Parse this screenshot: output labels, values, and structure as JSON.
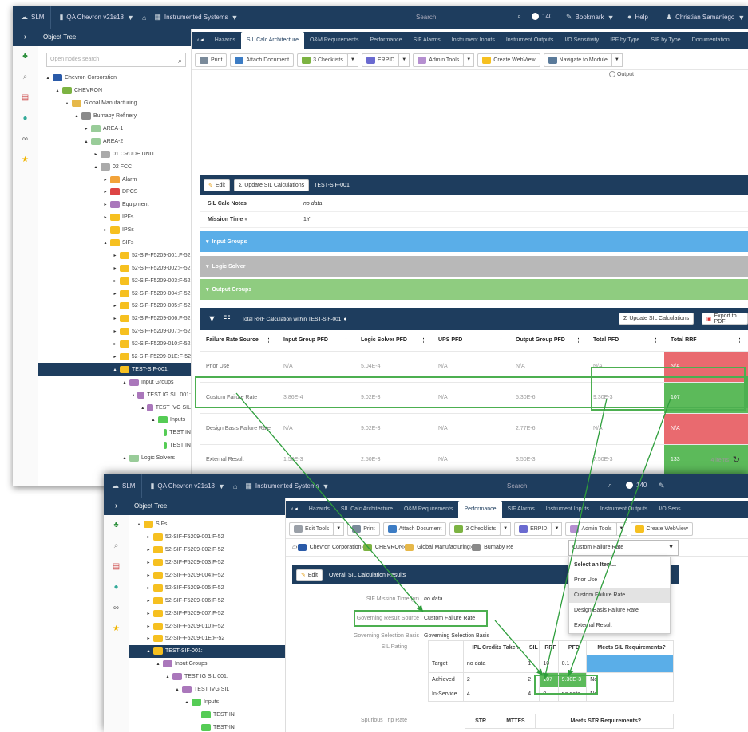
{
  "top": {
    "app": "SLM",
    "db": "QA Chevron v21s18",
    "module": "Instrumented Systems",
    "search": "Search",
    "count": "140",
    "bookmark": "Bookmark",
    "help": "Help",
    "user": "Christian Samaniego"
  },
  "sidebar": {
    "title": "Object Tree",
    "search_placeholder": "Open nodes search"
  },
  "tree": [
    "Chevron Corporation",
    "CHEVRON",
    "Global Manufacturing",
    "Burnaby Refinery",
    "AREA-1",
    "AREA-2",
    "01 CRUDE UNIT",
    "02 FCC",
    "Alarm",
    "DPCS",
    "Equipment",
    "IPFs",
    "IPSs",
    "SIFs",
    "52-SIF-F5209-001:F-52",
    "52-SIF-F5209-002:F-52",
    "52-SIF-F5209-003:F-52",
    "52-SIF-F5209-004:F-52",
    "52-SIF-F5209-005:F-52",
    "52-SIF-F5209-006:F-52",
    "52-SIF-F5209-007:F-52",
    "52-SIF-F5209-010:F-52",
    "52-SIF-F5209-01E:F-52",
    "TEST-SIF-001:",
    "Input Groups",
    "TEST IG SIL 001:",
    "TEST IVG SIL",
    "Inputs",
    "TEST IN",
    "TEST IN",
    "Logic Solvers"
  ],
  "tabs1": [
    "Hazards",
    "SIL Calc Architecture",
    "O&M Requirements",
    "Performance",
    "SIF Alarms",
    "Instrument Inputs",
    "Instrument Outputs",
    "I/O Sensitivity",
    "IPF by Type",
    "SIF by Type",
    "Documentation"
  ],
  "toolbar1": [
    "Print",
    "Attach Document",
    "3 Checklists",
    "ERPID",
    "Admin Tools",
    "Create WebView",
    "Navigate to Module"
  ],
  "output_label": "Output",
  "silcalc": {
    "edit": "Edit",
    "update": "Update SIL Calculations",
    "id": "TEST-SIF-001",
    "notes_label": "SIL Calc Notes",
    "notes_value": "no data",
    "mission_label": "Mission Time",
    "mission_value": "1Y",
    "groups": [
      "Input Groups",
      "Logic Solver",
      "Output Groups"
    ]
  },
  "grid": {
    "title": "Total RRF Calculation within TEST-SIF-001",
    "update": "Update SIL Calculations",
    "export": "Export to PDF",
    "headers": [
      "Failure Rate Source",
      "Input Group PFD",
      "Logic Solver PFD",
      "UPS PFD",
      "Output Group PFD",
      "Total PFD",
      "Total RRF"
    ],
    "rows": [
      [
        "Prior Use",
        "N/A",
        "5.04E-4",
        "N/A",
        "N/A",
        "N/A",
        "N/A"
      ],
      [
        "Custom Failure Rate",
        "3.86E-4",
        "9.02E-3",
        "N/A",
        "5.30E-6",
        "9.30E-3",
        "107"
      ],
      [
        "Design Basis Failure Rate",
        "N/A",
        "9.02E-3",
        "N/A",
        "2.77E-6",
        "N/A",
        "N/A"
      ],
      [
        "External Result",
        "1.50E-3",
        "2.50E-3",
        "N/A",
        "3.50E-3",
        "7.50E-3",
        "133"
      ]
    ],
    "footer": "4 items"
  },
  "win2": {
    "tabs": [
      "Hazards",
      "SIL Calc Architecture",
      "O&M Requirements",
      "Performance",
      "SIF Alarms",
      "Instrument Inputs",
      "Instrument Outputs",
      "I/O Sens"
    ],
    "toolbar": [
      "Edit Tools",
      "Print",
      "Attach Document",
      "3 Checklists",
      "ERPID",
      "Admin Tools",
      "Create WebView"
    ],
    "breadcrumb": [
      "Chevron Corporation",
      "CHEVRON",
      "Global Manufacturing",
      "Burnaby Re"
    ],
    "section": "Overall SIL Calculation Results",
    "edit": "Edit",
    "fields": [
      {
        "label": "SIF Mission Time (yr)",
        "value": "no data"
      },
      {
        "label": "Governing Result Source",
        "value": "Custom Failure Rate"
      },
      {
        "label": "Governing Selection Basis",
        "value": "Governing Selection Basis"
      }
    ],
    "sil_label": "SIL Rating",
    "spurious_label": "Spurious Trip Rate",
    "table_headers": [
      "IPL Credits Taken",
      "SIL",
      "RRF",
      "PFD",
      "Meets SIL Requirements?"
    ],
    "table_rows": [
      [
        "Target",
        "no data",
        "1",
        "10",
        "0.1"
      ],
      [
        "Achieved",
        "2",
        "2",
        "107",
        "9.30E-3",
        "No"
      ],
      [
        "In-Service",
        "4",
        "4",
        "0",
        "no data",
        "No"
      ]
    ],
    "str_headers": [
      "STR",
      "MTTFS",
      "Meets STR Requirements?"
    ],
    "select_value": "Custom Failure Rate",
    "dropdown": [
      "Select an Item...",
      "Prior Use",
      "Custom Failure Rate",
      "Design Basis Failure Rate",
      "External Result"
    ],
    "tree": [
      "SIFs",
      "52-SIF-F5209-001:F-52",
      "52-SIF-F5209-002:F-52",
      "52-SIF-F5209-003:F-52",
      "52-SIF-F5209-004:F-52",
      "52-SIF-F5209-005:F-52",
      "52-SIF-F5209-006:F-52",
      "52-SIF-F5209-007:F-52",
      "52-SIF-F5209-010:F-52",
      "52-SIF-F5209-01E:F-52",
      "TEST-SIF-001:",
      "Input Groups",
      "TEST IG SIL 001:",
      "TEST IVG SIL",
      "Inputs",
      "TEST-IN",
      "TEST-IN"
    ]
  },
  "colors": {
    "navy": "#1e3d5e",
    "blue_group": "#5aaee8",
    "gray_group": "#b8b8b8",
    "green_group": "#8fcc80",
    "red": "#e96a6f",
    "green": "#5cba5a",
    "highlight": "#4caf50"
  }
}
